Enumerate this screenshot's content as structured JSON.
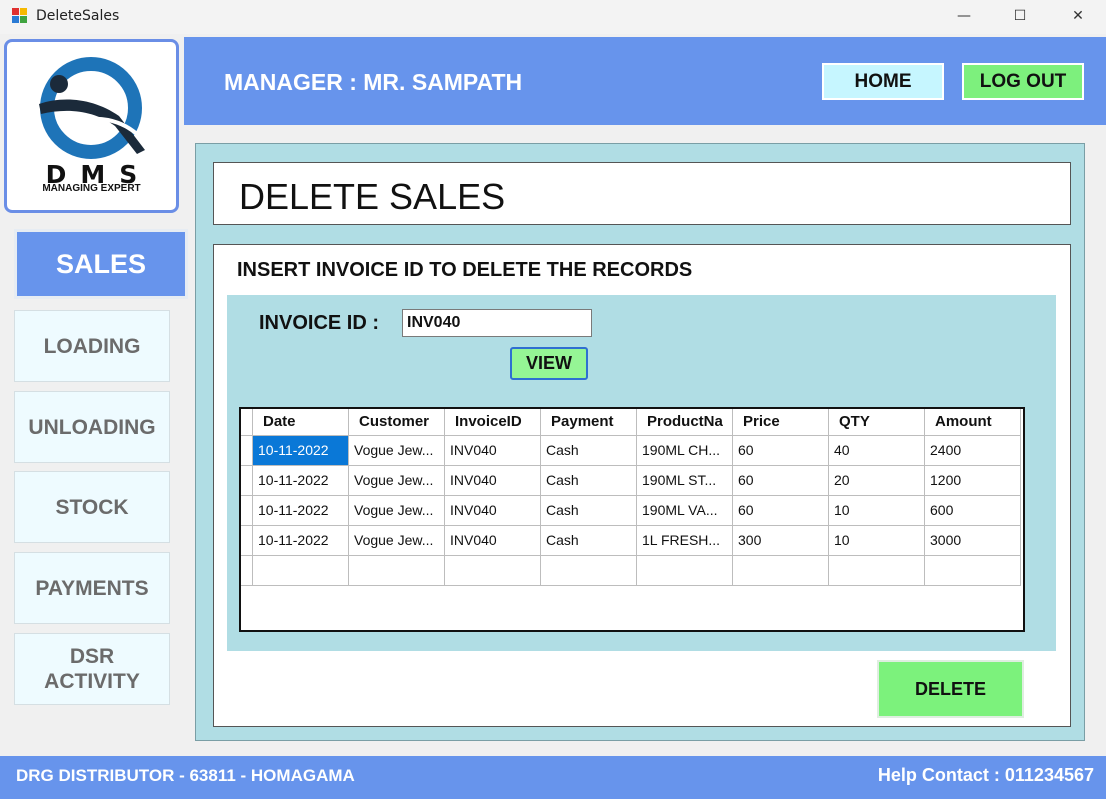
{
  "window": {
    "title": "DeleteSales",
    "min_icon": "—",
    "max_icon": "☐",
    "close_icon": "✕"
  },
  "logo": {
    "brand": "DMS",
    "tagline": "MANAGING EXPERT"
  },
  "header": {
    "manager": "MANAGER : MR. SAMPATH",
    "home_label": "HOME",
    "logout_label": "LOG OUT"
  },
  "nav": {
    "sales": "SALES",
    "loading": "LOADING",
    "unloading": "UNLOADING",
    "stock": "STOCK",
    "payments": "PAYMENTS",
    "dsr_line1": "DSR",
    "dsr_line2": "ACTIVITY"
  },
  "main": {
    "page_title": "DELETE SALES",
    "instruction": "INSERT INVOICE ID TO DELETE THE RECORDS",
    "invoice_label": "INVOICE ID :",
    "invoice_value": "INV040",
    "view_label": "VIEW",
    "delete_label": "DELETE"
  },
  "grid": {
    "columns": [
      "Date",
      "Customer",
      "InvoiceID",
      "Payment",
      "ProductNa",
      "Price",
      "QTY",
      "Amount"
    ],
    "rows": [
      [
        "10-11-2022",
        "Vogue Jew...",
        "INV040",
        "Cash",
        "190ML CH...",
        "60",
        "40",
        "2400"
      ],
      [
        "10-11-2022",
        "Vogue Jew...",
        "INV040",
        "Cash",
        "190ML ST...",
        "60",
        "20",
        "1200"
      ],
      [
        "10-11-2022",
        "Vogue Jew...",
        "INV040",
        "Cash",
        "190ML VA...",
        "60",
        "10",
        "600"
      ],
      [
        "10-11-2022",
        "Vogue Jew...",
        "INV040",
        "Cash",
        "1L FRESH...",
        "300",
        "10",
        "3000"
      ]
    ]
  },
  "footer": {
    "left": "DRG DISTRIBUTOR - 63811 - HOMAGAMA",
    "right": "Help  Contact : 011234567"
  },
  "colors": {
    "accent": "#6794ec",
    "panel": "#b0dde4",
    "green": "#7cf27c",
    "selection": "#0a78d7"
  }
}
